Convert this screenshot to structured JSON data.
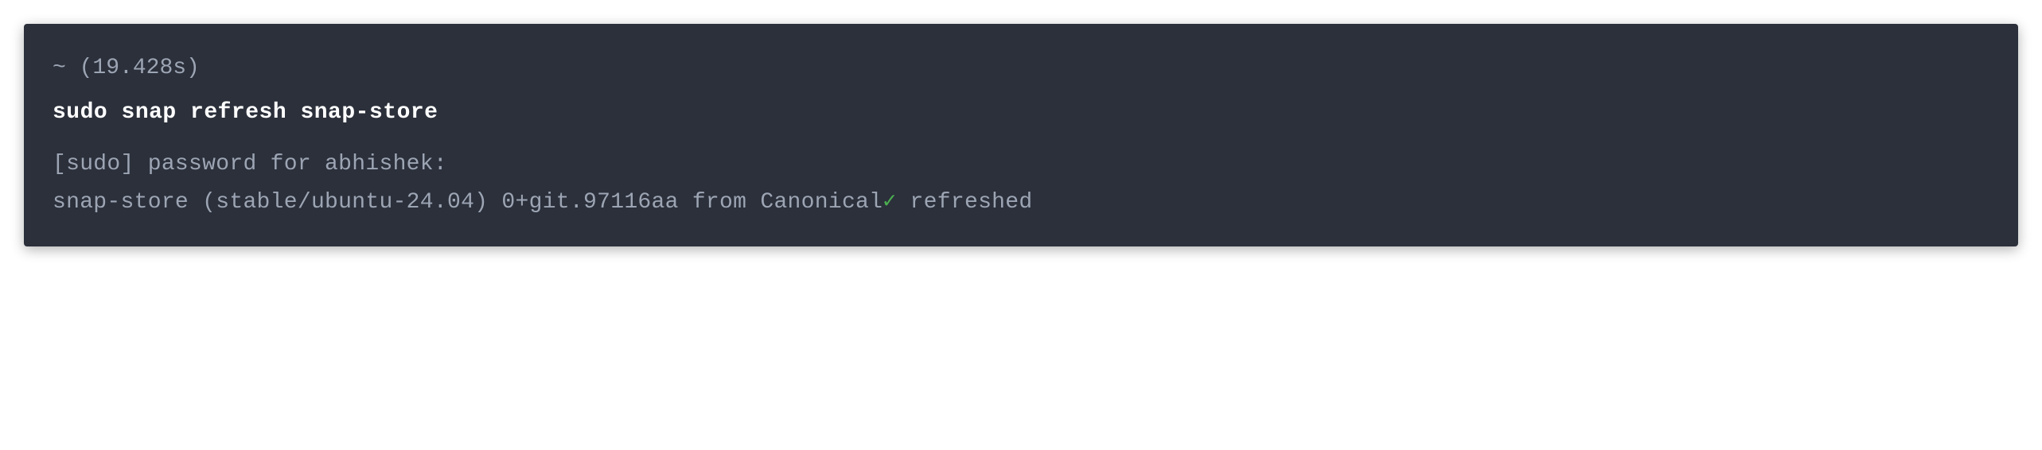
{
  "terminal": {
    "prompt": {
      "tilde": "~",
      "timing": "(19.428s)"
    },
    "command": "sudo snap refresh snap-store",
    "output": {
      "password_prompt": "[sudo] password for abhishek:",
      "result_prefix": "snap-store (stable/ubuntu-24.04) 0+git.97116aa from Canonical",
      "checkmark": "✓",
      "result_suffix": " refreshed"
    }
  }
}
